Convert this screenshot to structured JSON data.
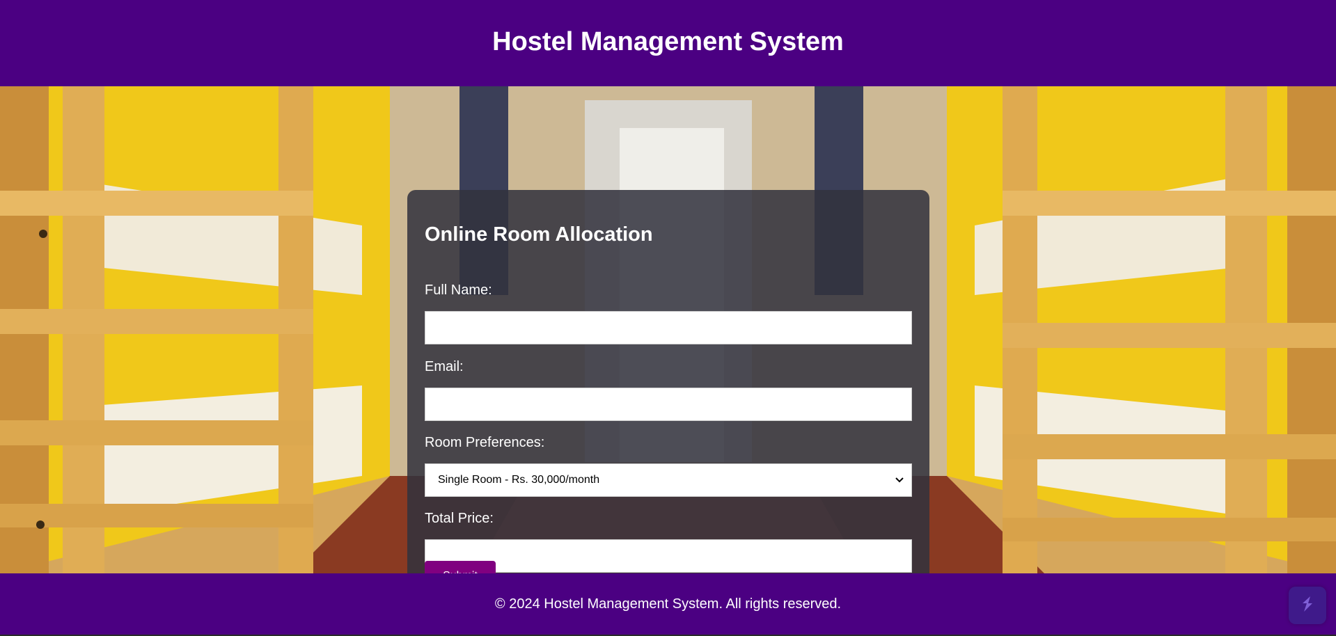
{
  "header": {
    "title": "Hostel Management System"
  },
  "form": {
    "title": "Online Room Allocation",
    "full_name": {
      "label": "Full Name:",
      "value": ""
    },
    "email": {
      "label": "Email:",
      "value": ""
    },
    "room_preferences": {
      "label": "Room Preferences:",
      "selected": "Single Room - Rs. 30,000/month"
    },
    "total_price": {
      "label": "Total Price:",
      "value": ""
    },
    "submit_label": "Submit"
  },
  "footer": {
    "text": "© 2024 Hostel Management System. All rights reserved."
  },
  "icons": {
    "select_chevron": "chevron-down-icon",
    "floating_widget": "widget-logo-icon"
  },
  "colors": {
    "header_bg": "#4b0082",
    "footer_bg": "#4b0082",
    "button_bg": "#800080",
    "card_bg": "rgba(50, 50, 62, 0.86)"
  }
}
